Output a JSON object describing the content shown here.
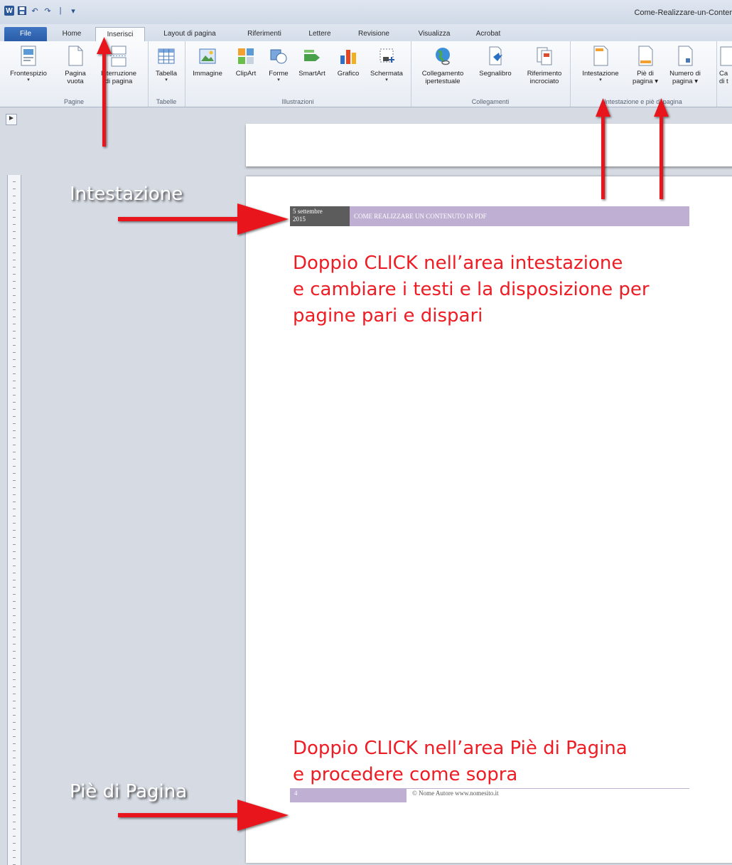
{
  "window": {
    "document_title": "Come-Realizzare-un-Conter"
  },
  "quick_access": {
    "logo": "W",
    "save_icon": "save-icon",
    "undo_glyph": "↶",
    "redo_glyph": "↷",
    "separator": "|",
    "customize_glyph": "▾"
  },
  "tabs": [
    "File",
    "Home",
    "Inserisci",
    "Layout di pagina",
    "Riferimenti",
    "Lettere",
    "Revisione",
    "Visualizza",
    "Acrobat"
  ],
  "active_tab": "Inserisci",
  "ribbon": {
    "groups": {
      "pagine": "Pagine",
      "tabelle": "Tabelle",
      "illustrazioni": "Illustrazioni",
      "collegamenti": "Collegamenti",
      "intestazione_pie": "Intestazione e piè di pagina"
    },
    "buttons": {
      "frontespizio": "Frontespizio",
      "pagina_vuota_1": "Pagina",
      "pagina_vuota_2": "vuota",
      "interruzione_1": "Interruzione",
      "interruzione_2": "di pagina",
      "tabella": "Tabella",
      "immagine": "Immagine",
      "clipart": "ClipArt",
      "forme": "Forme",
      "smartart": "SmartArt",
      "grafico": "Grafico",
      "schermata": "Schermata",
      "collegamento_1": "Collegamento",
      "collegamento_2": "ipertestuale",
      "segnalibro": "Segnalibro",
      "riferimento_1": "Riferimento",
      "riferimento_2": "incrociato",
      "intestazione": "Intestazione",
      "pie_1": "Piè di",
      "pie_2": "pagina ▾",
      "numero_1": "Numero di",
      "numero_2": "pagina ▾",
      "cut_1": "Ca",
      "cut_2": "di t"
    },
    "dropdown_caret": "▾"
  },
  "document": {
    "header_date_1": "5 settembre",
    "header_date_2": "2015",
    "header_title": "COME REALIZZARE UN CONTENUTO IN PDF",
    "footer_page": "4",
    "footer_text": "© Nome Autore www.nomesito.it"
  },
  "annotations": {
    "intestazione_label": "Intestazione",
    "pie_label": "Piè di Pagina",
    "note1": [
      "Doppio CLICK nell’area intestazione",
      "e cambiare i testi e la disposizione per",
      "pagine pari e dispari"
    ],
    "note2": [
      "Doppio CLICK nell’area Piè di Pagina",
      "e procedere come sopra"
    ],
    "arrow_color": "#e8141c",
    "text_color": "#ee1c24"
  },
  "colors": {
    "header_date_bg": "#5c5c5c",
    "header_bar_bg": "#bfb0d3",
    "file_tab_bg": "#2b5ca8"
  }
}
